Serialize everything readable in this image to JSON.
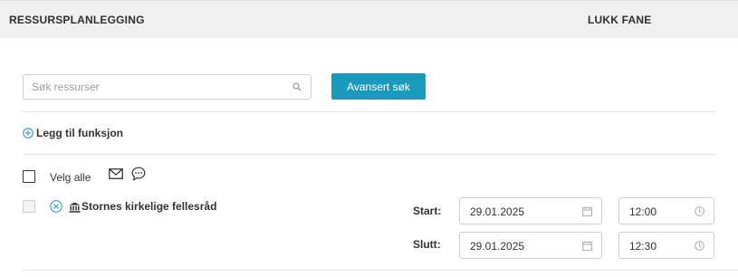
{
  "header": {
    "title": "RESSURSPLANLEGGING",
    "close_label": "LUKK FANE"
  },
  "search": {
    "placeholder": "Søk ressurser",
    "value": ""
  },
  "advanced_search_label": "Avansert søk",
  "add_function_label": "Legg til funksjon",
  "select_all_label": "Velg alle",
  "resource": {
    "name": "Stornes kirkelige fellesråd",
    "start_label": "Start:",
    "end_label": "Slutt:",
    "start_date": "29.01.2025",
    "start_time": "12:00",
    "end_date": "29.01.2025",
    "end_time": "12:30"
  },
  "colors": {
    "accent": "#1a9bbd",
    "header_bg": "#f0f0f0"
  },
  "icons": [
    "search-icon",
    "plus-circle-icon",
    "mail-icon",
    "chat-icon",
    "remove-circle-icon",
    "bank-icon",
    "calendar-icon",
    "clock-icon"
  ]
}
